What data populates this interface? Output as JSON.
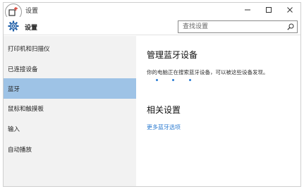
{
  "window": {
    "title": "设置",
    "controls": [
      {
        "name": "minimize",
        "glyph": "—"
      },
      {
        "name": "maximize",
        "glyph": "☐"
      },
      {
        "name": "close",
        "glyph": "✕"
      }
    ]
  },
  "header": {
    "title": "设置",
    "search_placeholder": "查找设置"
  },
  "sidebar": {
    "items": [
      {
        "label": "打印机和扫描仪",
        "active": false
      },
      {
        "label": "已连接设备",
        "active": false
      },
      {
        "label": "蓝牙",
        "active": true
      },
      {
        "label": "鼠标和触摸板",
        "active": false
      },
      {
        "label": "输入",
        "active": false
      },
      {
        "label": "自动播放",
        "active": false
      }
    ]
  },
  "main": {
    "bluetooth": {
      "title": "管理蓝牙设备",
      "description": "你的电脑正在搜索蓝牙设备，可以被这些设备发现。"
    },
    "related": {
      "title": "相关设置",
      "link": "更多蓝牙选项"
    }
  },
  "colors": {
    "accent": "#2a7ad0",
    "active_nav": "#9ec3e6",
    "sidebar_bg": "#f2f2f2"
  },
  "icons": [
    "back-arrow-icon",
    "gear-icon",
    "search-icon",
    "minimize-icon",
    "maximize-icon",
    "close-icon"
  ]
}
